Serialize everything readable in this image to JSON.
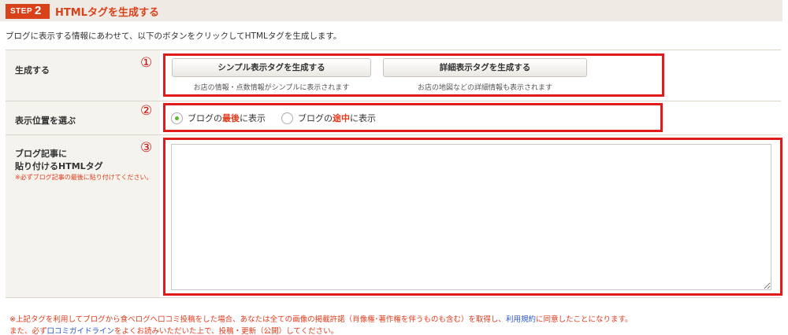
{
  "header": {
    "step_text": "STEP",
    "step_number": "2",
    "title": "HTMLタグを生成する"
  },
  "intro": "ブログに表示する情報にあわせて、以下のボタンをクリックしてHTMLタグを生成します。",
  "markers": {
    "one": "①",
    "two": "②",
    "three": "③"
  },
  "rows": {
    "generate": {
      "label": "生成する",
      "simple_button": "シンプル表示タグを生成する",
      "simple_desc": "お店の情報・点数情報がシンプルに表示されます",
      "detail_button": "詳細表示タグを生成する",
      "detail_desc": "お店の地図などの詳細情報も表示されます"
    },
    "position": {
      "label": "表示位置を選ぶ",
      "opt1_prefix": "ブログの",
      "opt1_emph": "最後",
      "opt1_suffix": "に表示",
      "opt1_selected": true,
      "opt2_prefix": "ブログの",
      "opt2_emph": "途中",
      "opt2_suffix": "に表示",
      "opt2_selected": false
    },
    "tag": {
      "label_line1": "ブログ記事に",
      "label_line2": "貼り付けるHTMLタグ",
      "note": "※必ずブログ記事の最後に貼り付けてください。",
      "textarea_value": ""
    }
  },
  "footer": {
    "line1_a": "※上記タグを利用してブログから食べログへ口コミ投稿をした場合、あなたは全ての画像の掲載許諾（肖像権･著作権を伴うものも含む）を取得し、",
    "line1_link": "利用規約",
    "line1_b": "に同意したことになります。",
    "line2_a": "また、必ず",
    "line2_link": "口コミガイドライン",
    "line2_b": "をよくお読みいただいた上で、投稿・更新（公開）してください。"
  },
  "colors": {
    "accent": "#d9411a",
    "highlight_box": "#e11b1b",
    "link": "#2a56c6",
    "radio_selected": "#5cb82f"
  }
}
